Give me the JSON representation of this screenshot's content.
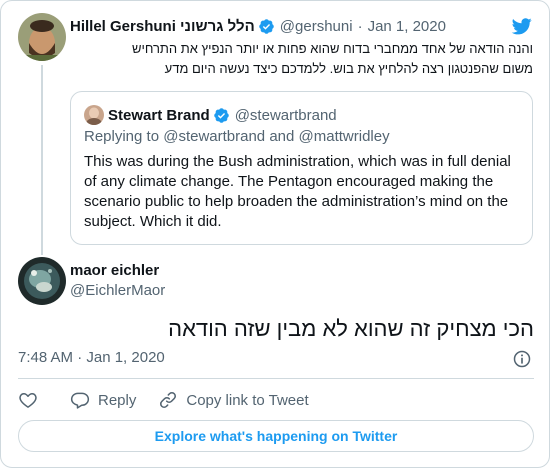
{
  "colors": {
    "accent": "#1d9bf0",
    "verified": "#1d9bf0",
    "muted_text": "#536471",
    "border": "#cfd9de"
  },
  "parent_tweet": {
    "name": "Hillel Gershuni הלל גרשוני",
    "handle": "@gershuni",
    "separator": "·",
    "date": "Jan 1, 2020",
    "verified_icon": "verified-badge-icon",
    "lines": [
      "והנה הודאה של אחד ממחברי בדוח שהוא פחות או יותר הנפיץ את התרחיש",
      "משום שהפנטגון רצה להלחיץ את בוש. ללמדכם כיצד נעשה היום מדע"
    ]
  },
  "quoted_tweet": {
    "name": "Stewart Brand",
    "handle": "@stewartbrand",
    "replying_to": "Replying to @stewartbrand and @mattwridley",
    "body": "This was during the Bush administration, which was in full denial of any climate change.  The Pentagon encouraged making the scenario public to help broaden the administration’s mind on the subject.  Which it did."
  },
  "main_tweet": {
    "name": "maor eichler",
    "handle": "@EichlerMaor",
    "text": "הכי מצחיק זה שהוא לא מבין שזה הודאה",
    "timestamp": "7:48 AM · Jan 1, 2020",
    "info_icon": "info-icon"
  },
  "actions": {
    "like_icon": "heart-icon",
    "reply_icon": "speech-bubble-icon",
    "reply_label": "Reply",
    "copy_icon": "link-icon",
    "copy_label": "Copy link to Tweet"
  },
  "explore_label": "Explore what's happening on Twitter",
  "brand_icon": "twitter-bird-icon"
}
